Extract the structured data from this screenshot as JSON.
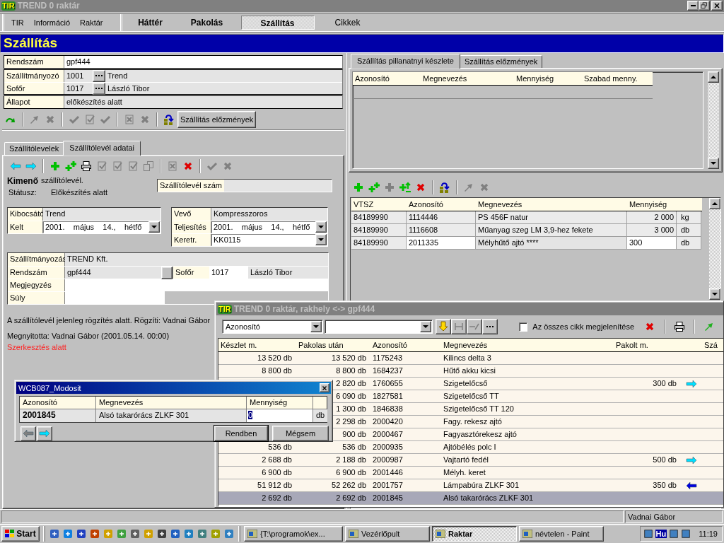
{
  "window": {
    "logo": "TIR",
    "title": "TREND 0 raktár"
  },
  "menu": [
    "TIR",
    "Információ",
    "Raktár"
  ],
  "modules": [
    {
      "label": "Háttér",
      "kind": "module",
      "selected": false
    },
    {
      "label": "Pakolás",
      "kind": "module",
      "selected": false
    },
    {
      "label": "Szállítás",
      "kind": "module",
      "selected": true
    },
    {
      "label": "Cikkek",
      "kind": "link",
      "selected": false
    }
  ],
  "page_title": "Szállítás",
  "header_form": [
    {
      "rows": [
        {
          "label": "Rendszám",
          "kind": "input",
          "value": "gpf444"
        }
      ]
    },
    {
      "rows": [
        {
          "label": "Szállítmányozó",
          "kind": "lookup",
          "code": "1001",
          "value": "Trend"
        },
        {
          "label": "Sofőr",
          "kind": "lookup",
          "code": "1017",
          "value": "László Tibor"
        }
      ]
    },
    {
      "rows": [
        {
          "label": "Állapot",
          "kind": "readonly",
          "value": "előkészítés alatt"
        }
      ]
    }
  ],
  "main_toolbar": {
    "tools": [
      {
        "kind": "redo",
        "disabled": false
      },
      {
        "kind": "separator"
      },
      {
        "kind": "up",
        "disabled": true
      },
      {
        "kind": "x",
        "disabled": true
      },
      {
        "kind": "separator"
      },
      {
        "kind": "check",
        "disabled": true
      },
      {
        "kind": "doccheck",
        "disabled": true
      },
      {
        "kind": "check",
        "disabled": true
      },
      {
        "kind": "separator"
      },
      {
        "kind": "docx",
        "disabled": true
      },
      {
        "kind": "x",
        "disabled": true
      },
      {
        "kind": "separator"
      },
      {
        "kind": "transfer",
        "disabled": false
      }
    ],
    "button": "Szállítás előzmények"
  },
  "left_tabs": [
    {
      "label": "Szállítólevelek",
      "selected": false
    },
    {
      "label": "Szállítólevél adatai",
      "selected": true
    }
  ],
  "doc_toolbar": [
    {
      "kind": "back",
      "disabled": false
    },
    {
      "kind": "forward",
      "disabled": false
    },
    {
      "kind": "separator"
    },
    {
      "kind": "plus",
      "disabled": false
    },
    {
      "kind": "plus2",
      "disabled": false
    },
    {
      "kind": "print",
      "disabled": false
    },
    {
      "kind": "doccheck",
      "disabled": true
    },
    {
      "kind": "doccheck",
      "disabled": true
    },
    {
      "kind": "doccheck",
      "disabled": true
    },
    {
      "kind": "copy",
      "disabled": true
    },
    {
      "kind": "separator"
    },
    {
      "kind": "docx",
      "disabled": true
    },
    {
      "kind": "x",
      "disabled": false
    },
    {
      "kind": "separator"
    },
    {
      "kind": "check",
      "disabled": true
    },
    {
      "kind": "x",
      "disabled": true
    }
  ],
  "doc": {
    "direction": "Kimenő",
    "type": "szállítólevél.",
    "status_label": "Státusz:",
    "status": "Előkészítés alatt",
    "number_label": "Szállítólevél szám"
  },
  "issuer": [
    {
      "label": "Kibocsátó",
      "kind": "text",
      "value": "Trend"
    },
    {
      "label": "Kelt",
      "kind": "combo",
      "value": "2001.    május    14.,    hétfő"
    }
  ],
  "customer": [
    {
      "label": "Vevő",
      "kind": "text",
      "value": "Kompresszoros"
    },
    {
      "label": "Teljesítés",
      "kind": "combo",
      "value": "2001.    május    14.,    hétfő"
    },
    {
      "label": "Keretr.",
      "kind": "combo",
      "value": "KK0115"
    }
  ],
  "transport": {
    "forwarder_label": "Szállítmányozás",
    "forwarder": "TREND Kft.",
    "plate_label": "Rendszám",
    "plate": "gpf444",
    "driver_label": "Sofőr",
    "driver_code": "1017",
    "driver": "László Tibor",
    "note_label": "Megjegyzés",
    "weight_label": "Súly"
  },
  "messages": [
    {
      "text": "A szállítólevél jelenleg rögzítés alatt. Rögzíti: Vadnai Gábor",
      "kind": "info"
    },
    {
      "text": "Megnyitotta: Vadnai Gábor (2001.05.14. 00:00)",
      "kind": "info"
    },
    {
      "text": "Szerkesztés alatt",
      "kind": "alert"
    }
  ],
  "right_tabs": [
    {
      "label": "Szállítás pillanatnyi készlete",
      "selected": true
    },
    {
      "label": "Szállítás előzmények",
      "selected": false
    }
  ],
  "stock_grid": {
    "columns": [
      "Azonosító",
      "Megnevezés",
      "Mennyiség",
      "Szabad menny."
    ]
  },
  "items_toolbar": [
    {
      "kind": "plus",
      "disabled": false
    },
    {
      "kind": "plus2",
      "disabled": false
    },
    {
      "kind": "plus",
      "disabled": true
    },
    {
      "kind": "plusbar",
      "disabled": false
    },
    {
      "kind": "x",
      "disabled": false
    },
    {
      "kind": "separator"
    },
    {
      "kind": "transfer",
      "disabled": false
    },
    {
      "kind": "separator"
    },
    {
      "kind": "up",
      "disabled": true
    },
    {
      "kind": "x",
      "disabled": true
    }
  ],
  "items_grid": {
    "columns": [
      "VTSZ",
      "Azonosító",
      "Megnevezés",
      "Mennyiség"
    ],
    "rows": [
      {
        "vtsz": "84189990",
        "id": "1114446",
        "name": "PS 456F natur",
        "qty": "2 000",
        "unit": "kg",
        "editing": false
      },
      {
        "vtsz": "84189990",
        "id": "1116608",
        "name": "Műanyag szeg LM 3,9-hez fekete",
        "qty": "3 000",
        "unit": "db",
        "editing": false
      },
      {
        "vtsz": "84189990",
        "id": "2011335",
        "name": "Mélyhűtő ajtó ****",
        "qty": "300",
        "unit": "db",
        "editing": true
      }
    ]
  },
  "stock_window": {
    "logo": "TIR",
    "title": "TREND 0 raktár, rakhely <-> gpf444",
    "search_field": "Azonosító",
    "buttons": [
      {
        "kind": "down",
        "disabled": false
      },
      {
        "kind": "bracket",
        "disabled": true
      },
      {
        "kind": "slash",
        "disabled": true
      },
      {
        "kind": "dots",
        "disabled": false
      }
    ],
    "show_all": {
      "label": "Az összes cikk megjelenítése",
      "checked": false
    },
    "tools": [
      {
        "kind": "x",
        "disabled": false
      },
      {
        "kind": "separator"
      },
      {
        "kind": "print",
        "disabled": false
      },
      {
        "kind": "separator"
      },
      {
        "kind": "up",
        "disabled": false
      }
    ],
    "columns": [
      "Készlet m.",
      "Pakolas után",
      "Azonosító",
      "Megnevezés",
      "Pakolt m.",
      "Szá"
    ],
    "rows": [
      {
        "stock": "13 520 db",
        "after": "13 520 db",
        "id": "1175243",
        "name": "Kilincs delta 3",
        "kind": "plain",
        "selected": false
      },
      {
        "stock": "8 800 db",
        "after": "8 800 db",
        "id": "1684237",
        "name": "Hűtő akku kicsi",
        "kind": "plain",
        "selected": false
      },
      {
        "after": "2 820 db",
        "id": "1760655",
        "name": "Szigetelőcső",
        "packed": "300 db",
        "kind": "right",
        "selected": false
      },
      {
        "after": "6 090 db",
        "id": "1827581",
        "name": "Szigetelőcső TT",
        "kind": "plain",
        "selected": false
      },
      {
        "after": "1 300 db",
        "id": "1846838",
        "name": "Szigetelőcső TT 120",
        "kind": "plain",
        "selected": false
      },
      {
        "after": "2 298 db",
        "id": "2000420",
        "name": "Fagy. rekesz ajtó",
        "kind": "plain",
        "selected": false
      },
      {
        "after": "900 db",
        "id": "2000467",
        "name": "Fagyasztórekesz ajtó",
        "kind": "plain",
        "selected": false
      },
      {
        "stock": "536 db",
        "after": "536 db",
        "id": "2000935",
        "name": "Ajtóbélés polc I",
        "kind": "plain",
        "selected": false
      },
      {
        "stock": "2 688 db",
        "after": "2 188 db",
        "id": "2000987",
        "name": "Vajtartó fedél",
        "packed": "500 db",
        "kind": "right",
        "selected": false
      },
      {
        "stock": "6 900 db",
        "after": "6 900 db",
        "id": "2001446",
        "name": "Mélyh. keret",
        "kind": "plain",
        "selected": false
      },
      {
        "stock": "51 912 db",
        "after": "52 262 db",
        "id": "2001757",
        "name": "Lámpabúra ZLKF 301",
        "packed": "350 db",
        "kind": "left",
        "selected": false
      },
      {
        "stock": "2 692 db",
        "after": "2 692 db",
        "id": "2001845",
        "name": "Alsó takarórács ZLKF 301",
        "kind": "plain",
        "selected": true
      }
    ]
  },
  "dialog": {
    "title": "WCB087_Modosit",
    "columns": [
      "Azonosító",
      "Megnevezés",
      "Mennyiség"
    ],
    "id": "2001845",
    "name": "Alsó takarórács ZLKF 301",
    "qty": "0",
    "unit": "db",
    "back_disabled": true,
    "forward_disabled": false,
    "buttons": [
      "Rendben",
      "Mégsem"
    ]
  },
  "status_bar": {
    "user": "Vadnai Gábor"
  },
  "taskbar": {
    "start": "Start",
    "tasks": [
      {
        "label": "{T:\\programok\\ex...",
        "selected": false
      },
      {
        "label": "Vezérlőpult",
        "selected": false
      },
      {
        "label": "Raktar",
        "selected": true
      },
      {
        "label": "névtelen - Paint",
        "selected": false
      }
    ],
    "language": "Hu",
    "clock": "11:19"
  }
}
